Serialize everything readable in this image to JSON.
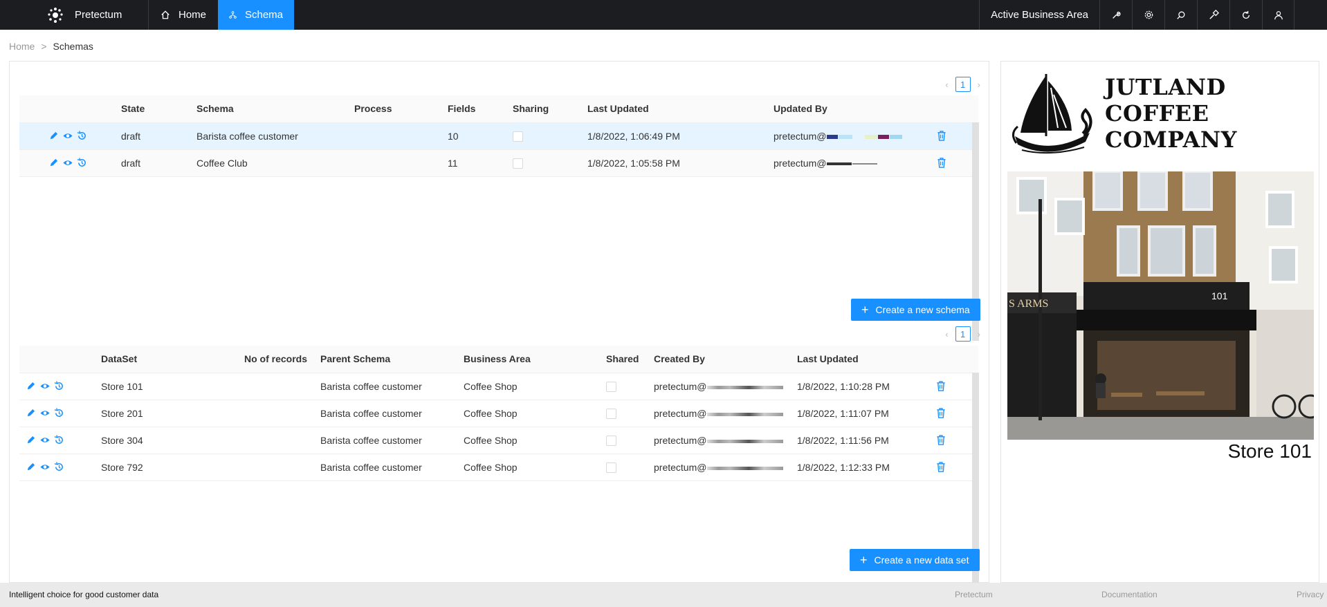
{
  "app": {
    "name": "Pretectum"
  },
  "nav": {
    "home": "Home",
    "schema": "Schema"
  },
  "top_right": {
    "business_area": "Active Business Area",
    "icons": [
      "wrench-icon",
      "gear-icon",
      "search-icon",
      "hammer-icon",
      "refresh-icon",
      "user-icon"
    ]
  },
  "breadcrumb": {
    "home": "Home",
    "sep": ">",
    "current": "Schemas"
  },
  "schemas": {
    "page": "1",
    "headers": {
      "state": "State",
      "schema": "Schema",
      "process": "Process",
      "fields": "Fields",
      "sharing": "Sharing",
      "last_updated": "Last Updated",
      "updated_by": "Updated By"
    },
    "rows": [
      {
        "state": "draft",
        "schema": "Barista coffee customer",
        "process": "",
        "fields": "10",
        "last_updated": "1/8/2022, 1:06:49 PM",
        "updated_by": "pretectum@"
      },
      {
        "state": "draft",
        "schema": "Coffee Club",
        "process": "",
        "fields": "11",
        "last_updated": "1/8/2022, 1:05:58 PM",
        "updated_by": "pretectum@"
      }
    ],
    "create_button": "Create a new schema"
  },
  "datasets": {
    "page": "1",
    "headers": {
      "dataset": "DataSet",
      "records": "No of records",
      "parent": "Parent Schema",
      "business_area": "Business Area",
      "shared": "Shared",
      "created_by": "Created By",
      "last_updated": "Last Updated"
    },
    "rows": [
      {
        "dataset": "Store 101",
        "records": "",
        "parent": "Barista coffee customer",
        "business_area": "Coffee Shop",
        "created_by": "pretectum@",
        "last_updated": "1/8/2022, 1:10:28 PM"
      },
      {
        "dataset": "Store 201",
        "records": "",
        "parent": "Barista coffee customer",
        "business_area": "Coffee Shop",
        "created_by": "pretectum@",
        "last_updated": "1/8/2022, 1:11:07 PM"
      },
      {
        "dataset": "Store 304",
        "records": "",
        "parent": "Barista coffee customer",
        "business_area": "Coffee Shop",
        "created_by": "pretectum@",
        "last_updated": "1/8/2022, 1:11:56 PM"
      },
      {
        "dataset": "Store 792",
        "records": "",
        "parent": "Barista coffee customer",
        "business_area": "Coffee Shop",
        "created_by": "pretectum@",
        "last_updated": "1/8/2022, 1:12:33 PM"
      }
    ],
    "create_button": "Create a new data set"
  },
  "side": {
    "company_line1": "JUTLAND",
    "company_line2": "COFFEE",
    "company_line3": "COMPANY",
    "store_sign_left": "S ARMS",
    "store_number": "101",
    "store_label": "Store 101"
  },
  "footer": {
    "tagline": "Intelligent choice for good customer data",
    "link1": "Pretectum",
    "link2": "Documentation",
    "link3": "Privacy"
  },
  "colors": {
    "primary": "#1890ff",
    "topbar": "#1b1d21",
    "selected_row": "#e6f4ff"
  }
}
